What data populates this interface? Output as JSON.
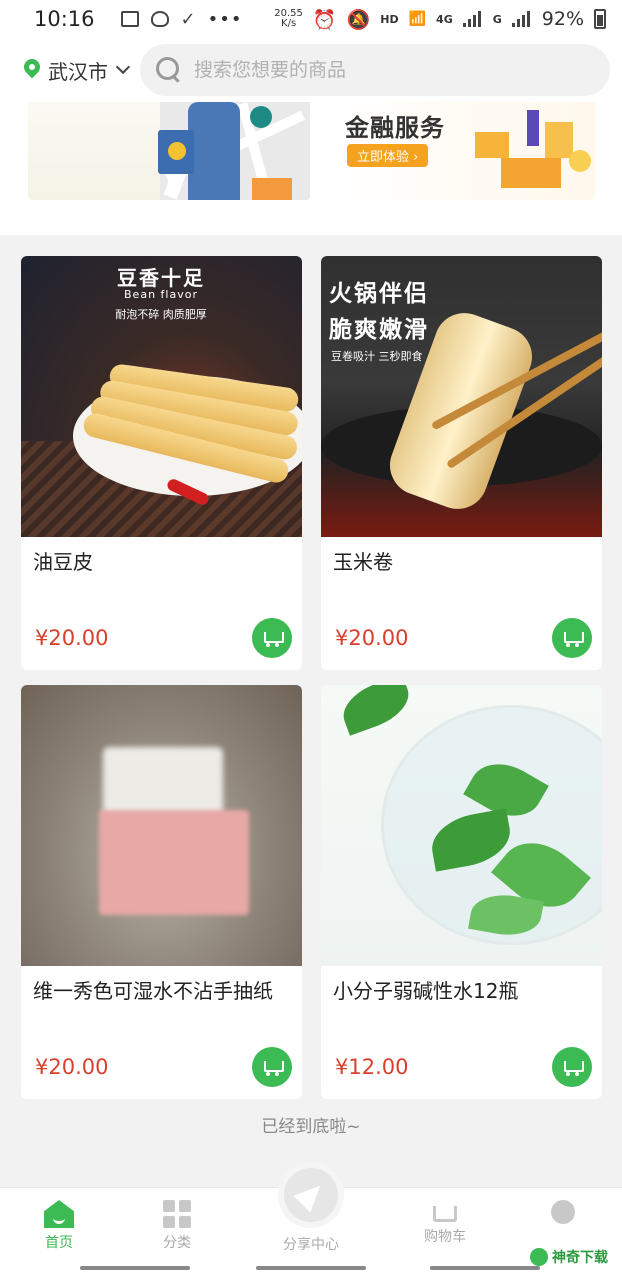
{
  "status_bar": {
    "time": "10:16",
    "net_speed_top": "20.55",
    "net_speed_unit": "K/s",
    "hd": "HD",
    "wifi_label": "4G",
    "signal2_label": "G",
    "battery": "92%"
  },
  "header": {
    "city": "武汉市",
    "search_placeholder": "搜索您想要的商品"
  },
  "banners": [
    {
      "title": "",
      "button": ""
    },
    {
      "title": "金融服务",
      "button": "立即体验 ›"
    }
  ],
  "products": [
    {
      "name": "油豆皮",
      "price": "¥20.00",
      "img_title": "豆香十足",
      "img_sub": "Bean flavor",
      "img_tags": "耐泡不碎  肉质肥厚"
    },
    {
      "name": "玉米卷",
      "price": "¥20.00",
      "img_title": "火锅伴侣",
      "img_title2": "脆爽嫩滑",
      "img_tags": "豆卷吸汁 三秒即食"
    },
    {
      "name": "维一秀色可湿水不沾手抽纸",
      "price": "¥20.00"
    },
    {
      "name": "小分子弱碱性水12瓶",
      "price": "¥12.00"
    }
  ],
  "end_tip": "已经到底啦~",
  "bottom_nav": {
    "home": "首页",
    "category": "分类",
    "share": "分享中心",
    "cart": "购物车",
    "mine": ""
  },
  "watermark": "神奇下载",
  "colors": {
    "accent": "#3cba54",
    "price": "#d9402c"
  }
}
